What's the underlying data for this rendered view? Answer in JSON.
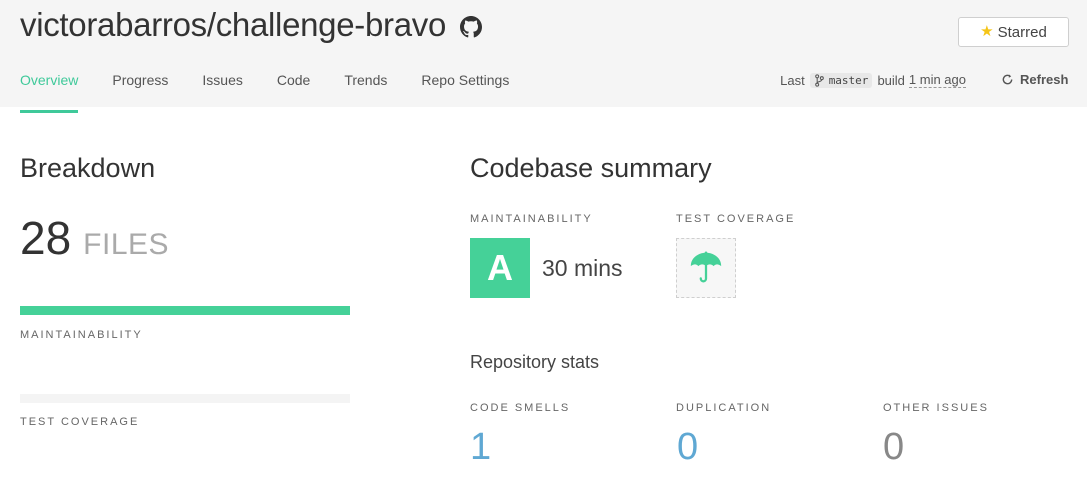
{
  "header": {
    "repo_title": "victorabarros/challenge-bravo",
    "star_button_label": "Starred",
    "tabs": [
      {
        "label": "Overview",
        "active": true
      },
      {
        "label": "Progress",
        "active": false
      },
      {
        "label": "Issues",
        "active": false
      },
      {
        "label": "Code",
        "active": false
      },
      {
        "label": "Trends",
        "active": false
      },
      {
        "label": "Repo Settings",
        "active": false
      }
    ],
    "build": {
      "prefix": "Last",
      "branch": "master",
      "build_word": "build",
      "time_ago": "1 min ago"
    },
    "refresh_label": "Refresh"
  },
  "breakdown": {
    "heading": "Breakdown",
    "files_count": "28",
    "files_unit": "FILES",
    "maintainability_label": "MAINTAINABILITY",
    "maintainability_fill": 1.0,
    "test_coverage_label": "TEST COVERAGE",
    "test_coverage_fill": 0
  },
  "summary": {
    "heading": "Codebase summary",
    "maintainability_label": "MAINTAINABILITY",
    "grade": "A",
    "tech_debt": "30 mins",
    "test_coverage_label": "TEST COVERAGE"
  },
  "repo_stats": {
    "heading": "Repository stats",
    "items": [
      {
        "label": "CODE SMELLS",
        "value": "1"
      },
      {
        "label": "DUPLICATION",
        "value": "0"
      },
      {
        "label": "OTHER ISSUES",
        "value": "0"
      }
    ]
  },
  "colors": {
    "accent_green": "#45d198",
    "link_blue": "#5fa8d3",
    "star_yellow": "#f5c518"
  },
  "icons": {
    "repo_host": "github-icon",
    "star": "star-icon",
    "branch": "branch-icon",
    "refresh": "refresh-icon",
    "coverage_placeholder": "umbrella-icon"
  }
}
